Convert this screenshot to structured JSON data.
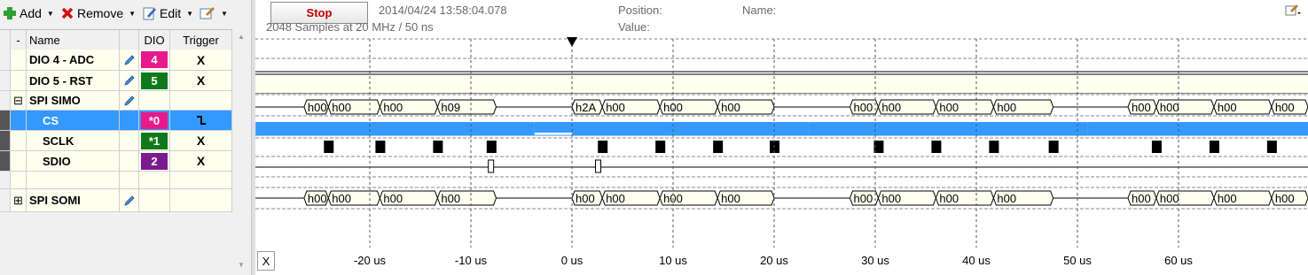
{
  "toolbar": {
    "add_label": "Add",
    "remove_label": "Remove",
    "edit_label": "Edit"
  },
  "columns": {
    "dash": "-",
    "name": "Name",
    "dio": "DIO",
    "trigger": "Trigger"
  },
  "channels": [
    {
      "name": "DIO 4 - ADC",
      "dio": "4",
      "dio_color": "#e8198b",
      "trigger": "X",
      "expander": "",
      "has_pencil": true,
      "selected": false
    },
    {
      "name": "DIO 5 - RST",
      "dio": "5",
      "dio_color": "#0f7a1b",
      "trigger": "X",
      "expander": "",
      "has_pencil": true,
      "selected": false
    },
    {
      "name": "SPI SIMO",
      "dio": "",
      "dio_color": "",
      "trigger": "",
      "expander": "⊟",
      "has_pencil": true,
      "selected": false
    },
    {
      "name": "CS",
      "dio": "*0",
      "dio_color": "#e8198b",
      "trigger": "falling-edge",
      "expander": "",
      "has_pencil": false,
      "selected": true
    },
    {
      "name": "SCLK",
      "dio": "*1",
      "dio_color": "#0f7a1b",
      "trigger": "X",
      "expander": "",
      "has_pencil": false,
      "selected": false
    },
    {
      "name": "SDIO",
      "dio": "2",
      "dio_color": "#7b1a8f",
      "trigger": "X",
      "expander": "",
      "has_pencil": false,
      "selected": false
    },
    {
      "name": "",
      "dio": "",
      "dio_color": "",
      "trigger": "",
      "expander": "",
      "has_pencil": false,
      "selected": false
    },
    {
      "name": "SPI SOMI",
      "dio": "",
      "dio_color": "",
      "trigger": "",
      "expander": "⊞",
      "has_pencil": true,
      "selected": false
    }
  ],
  "control": {
    "stop_label": "Stop",
    "timestamp": "2014/04/24  13:58:04.078",
    "samples": "2048 Samples at 20 MHz / 50 ns",
    "position_label": "Position:",
    "value_label": "Value:",
    "name_label": "Name:"
  },
  "spi_simo_words": [
    "h00",
    "h00",
    "h00",
    "h09",
    "h2A",
    "h00",
    "h00",
    "h00",
    "h00",
    "h00",
    "h00",
    "h00",
    "h00",
    "h00",
    "h00",
    "h00"
  ],
  "spi_somi_words": [
    "h00",
    "h00",
    "h00",
    "h00",
    "h00",
    "h00",
    "h00",
    "h00",
    "h00",
    "h00",
    "h00",
    "h00",
    "h00",
    "h00",
    "h00",
    "h00"
  ],
  "time_axis": {
    "close_label": "X",
    "ticks": [
      "-20 us",
      "-10 us",
      "0 us",
      "10 us",
      "20 us",
      "30 us",
      "40 us",
      "50 us",
      "60 us"
    ],
    "tick_values_us": [
      -20,
      -10,
      0,
      10,
      20,
      30,
      40,
      50,
      60
    ]
  },
  "colors": {
    "cs_fill": "#3399ff",
    "bus_fill": "#fffff0",
    "grid": "#000000"
  }
}
